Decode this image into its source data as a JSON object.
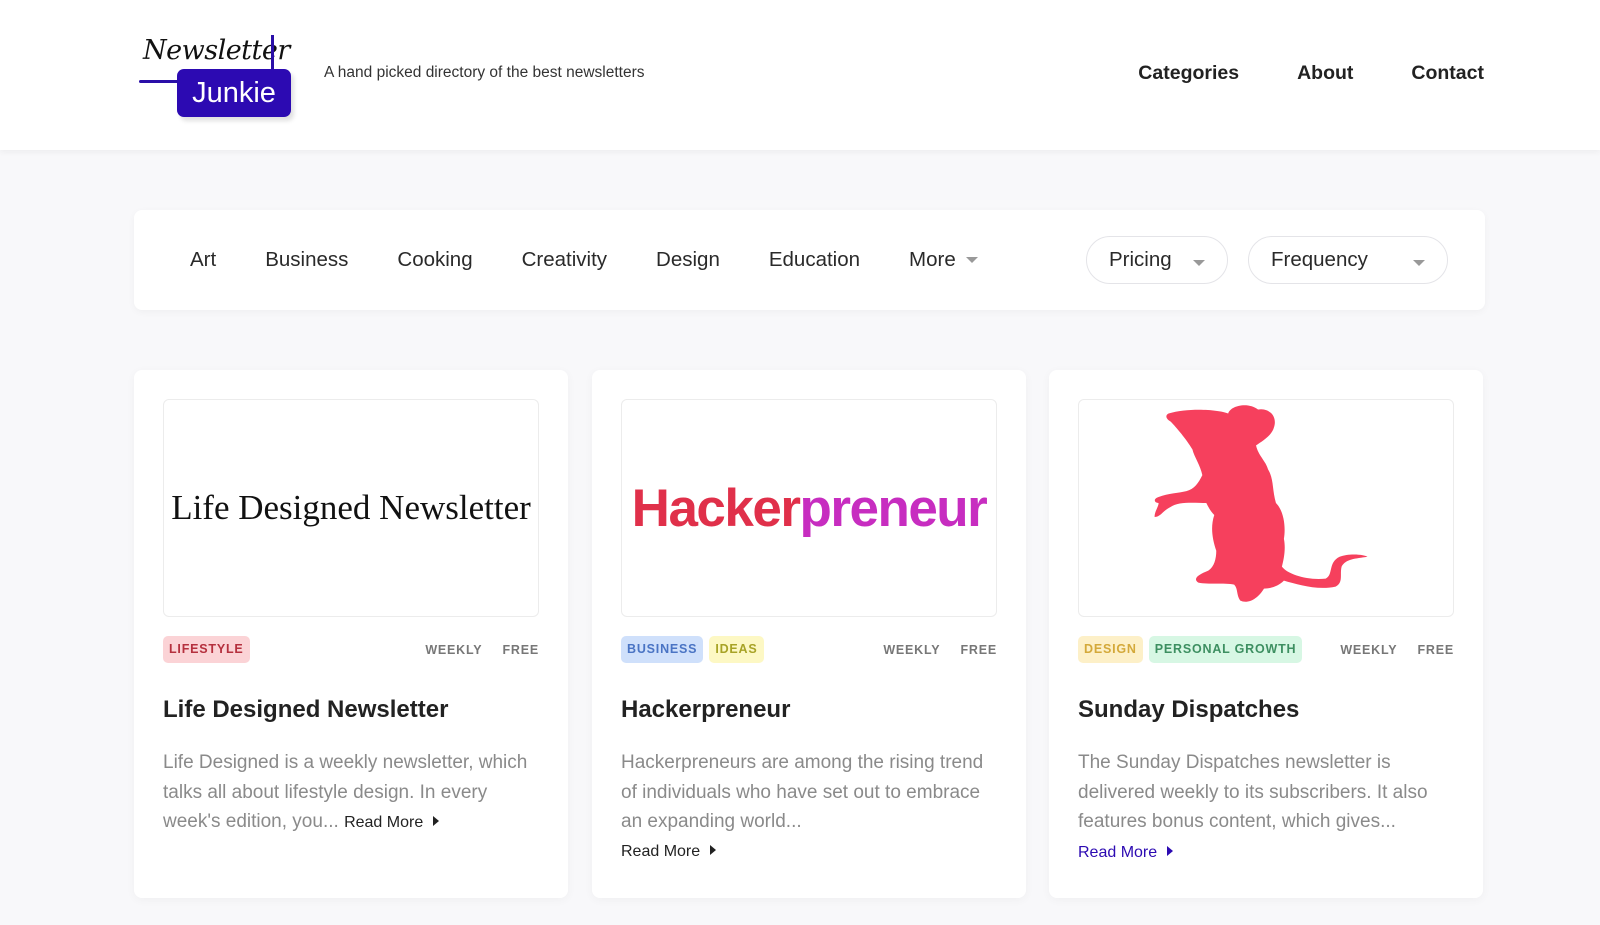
{
  "header": {
    "logo": {
      "script_text": "Newsletter",
      "box_text": "Junkie",
      "brand_color": "#2c0ab2"
    },
    "tagline": "A hand picked directory of the best newsletters",
    "nav": [
      {
        "label": "Categories"
      },
      {
        "label": "About"
      },
      {
        "label": "Contact"
      }
    ]
  },
  "filters": {
    "categories": [
      "Art",
      "Business",
      "Cooking",
      "Creativity",
      "Design",
      "Education"
    ],
    "more_label": "More",
    "pricing_label": "Pricing",
    "frequency_label": "Frequency"
  },
  "cards": [
    {
      "thumb_text": "Life Designed Newsletter",
      "tags": [
        {
          "label": "LIFESTYLE",
          "bg": "#fbd3d6",
          "fg": "#b5303e"
        }
      ],
      "frequency": "WEEKLY",
      "pricing": "FREE",
      "title": "Life Designed Newsletter",
      "description": "Life Designed is a weekly newsletter, which talks all about lifestyle design. In every week's edition, you...",
      "read_more": "Read More",
      "read_more_color": "#222222"
    },
    {
      "thumb_text_part1": "Hacker",
      "thumb_text_part2": "preneur",
      "tags": [
        {
          "label": "BUSINESS",
          "bg": "#cfe0fb",
          "fg": "#4a74c4"
        },
        {
          "label": "IDEAS",
          "bg": "#fdf8c4",
          "fg": "#a8a326"
        }
      ],
      "frequency": "WEEKLY",
      "pricing": "FREE",
      "title": "Hackerpreneur",
      "description": "Hackerpreneurs are among the rising trend of individuals who have set out to embrace an expanding world...",
      "read_more": "Read More",
      "read_more_color": "#222222"
    },
    {
      "thumb_image": "rat-silhouette",
      "thumb_color": "#f6405d",
      "tags": [
        {
          "label": "DESIGN",
          "bg": "#fdf0c8",
          "fg": "#d4a93a"
        },
        {
          "label": "PERSONAL GROWTH",
          "bg": "#d7f7e4",
          "fg": "#3d8f61"
        }
      ],
      "frequency": "WEEKLY",
      "pricing": "FREE",
      "title": "Sunday Dispatches",
      "description": "The Sunday Dispatches newsletter is delivered weekly to its subscribers. It also features bonus content, which gives...",
      "read_more": "Read More",
      "read_more_color": "#2c0ab2"
    }
  ]
}
